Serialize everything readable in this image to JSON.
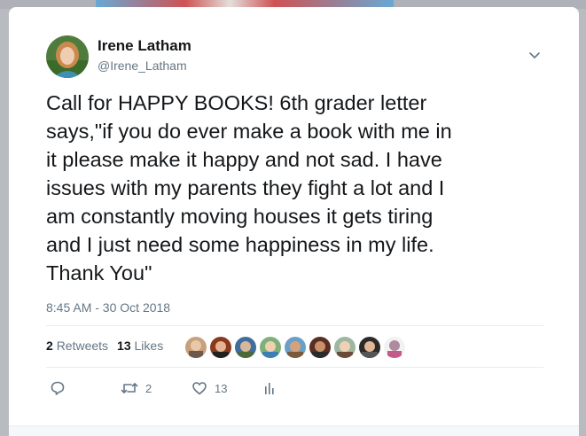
{
  "tweet": {
    "author_name": "Irene Latham",
    "author_handle": "@Irene_Latham",
    "text": "Call for HAPPY BOOKS! 6th grader letter\nsays,\"if you do ever make a book with me in\nit please make it happy and not sad. I have\nissues with my parents they fight a lot and I\nam constantly moving houses it gets tiring\nand I just need some happiness in my life.\nThank You\"",
    "timestamp": "8:45 AM - 30 Oct 2018"
  },
  "stats": {
    "retweets_count": "2",
    "retweets_label": "Retweets",
    "likes_count": "13",
    "likes_label": "Likes"
  },
  "actions": {
    "reply_count": "",
    "retweet_count": "2",
    "like_count": "13"
  },
  "icons": [
    "avatar",
    "chevron-down-icon",
    "reply-icon",
    "retweet-icon",
    "heart-icon",
    "analytics-icon"
  ],
  "colors": {
    "text_primary": "#14171a",
    "text_secondary": "#657786",
    "divider": "#e6ecf0",
    "backdrop": "#b8bcc1"
  }
}
